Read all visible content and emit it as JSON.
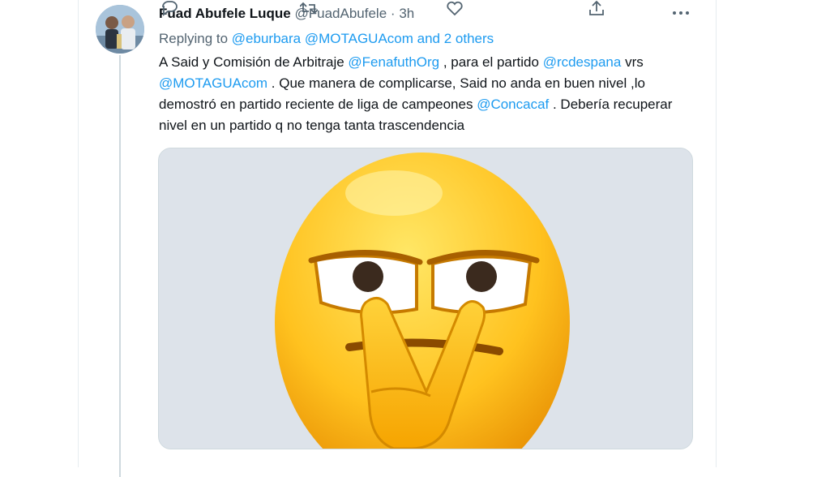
{
  "tweet": {
    "author_name": "Fuad Abufele Luque",
    "handle": "@FuadAbufele",
    "separator": "·",
    "time": "3h",
    "replying_to_prefix": "Replying to",
    "reply_mentions": [
      "@eburbara",
      "@MOTAGUAcom"
    ],
    "reply_others": "and 2 others",
    "text": {
      "p1": "A Said y Comisión de Arbitraje ",
      "m1": "@FenafuthOrg",
      "p2": " , para el partido ",
      "m2": "@rcdespana",
      "p3": " vrs ",
      "m3": "@MOTAGUAcom",
      "p4": " . Que manera de complicarse, Said no anda en buen nivel ,lo demostró en partido reciente de liga de campeones ",
      "m4": "@Concacaf",
      "p5": " . Debería recuperar nivel en un partido q no tenga tanta trascendencia"
    },
    "media": {
      "description_icon": "emoji-eye-pull-face",
      "background": "#dde3ea"
    },
    "actions": [
      "reply-icon",
      "retweet-icon",
      "like-icon",
      "share-icon"
    ]
  },
  "colors": {
    "link": "#1d9bf0",
    "secondary_text": "#536471",
    "border": "#cfd9de"
  }
}
